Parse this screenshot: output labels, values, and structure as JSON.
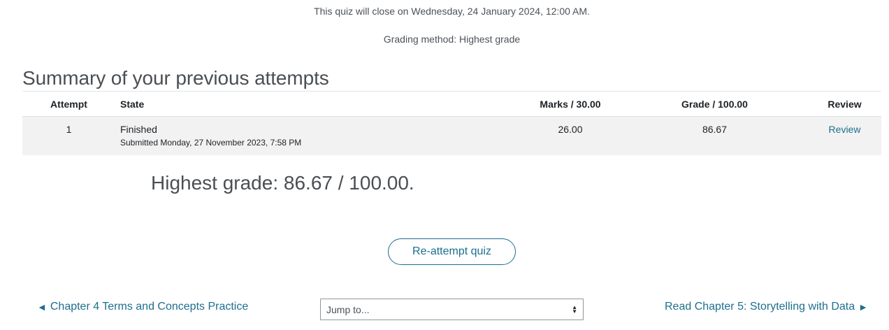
{
  "quiz": {
    "close_notice": "This quiz will close on Wednesday, 24 January 2024, 12:00 AM.",
    "grading_method": "Grading method: Highest grade"
  },
  "summary": {
    "heading": "Summary of your previous attempts",
    "columns": [
      "Attempt",
      "State",
      "Marks / 30.00",
      "Grade / 100.00",
      "Review"
    ],
    "rows": [
      {
        "attempt": "1",
        "state": "Finished",
        "submitted": "Submitted Monday, 27 November 2023, 7:58 PM",
        "marks": "26.00",
        "grade": "86.67",
        "review": "Review"
      }
    ]
  },
  "feedback": {
    "highest_grade": "Highest grade: 86.67 / 100.00."
  },
  "actions": {
    "reattempt_label": "Re-attempt quiz"
  },
  "navigation": {
    "prev_label": "Chapter 4 Terms and Concepts Practice",
    "prev_arrow": "◄",
    "jump_placeholder": "Jump to...",
    "next_label": "Read Chapter 5: Storytelling with Data",
    "next_arrow": "►"
  },
  "colors": {
    "link": "#1d6f8e",
    "row_background": "#f2f2f2",
    "heading_text": "#4a4f54"
  }
}
